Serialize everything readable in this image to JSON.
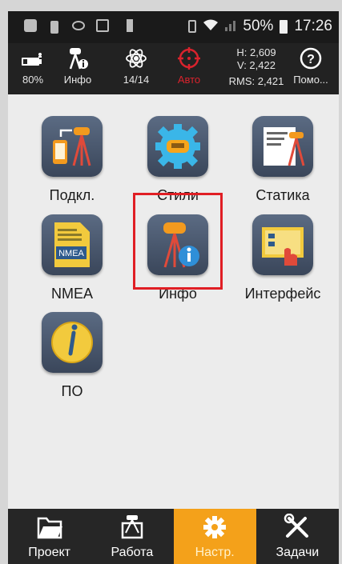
{
  "status_bar": {
    "battery_percent": "50%",
    "time": "17:26"
  },
  "toolbar": {
    "battery_label": "80%",
    "info_label": "Инфо",
    "satellites_label": "14/14",
    "solution_label": "Авто",
    "h_value": "H: 2,609",
    "v_value": "V: 2,422",
    "rms_value": "RMS: 2,421",
    "help_label": "Помо...",
    "help_glyph": "?"
  },
  "tiles": [
    {
      "label": "Подкл.",
      "icon": "connect-icon"
    },
    {
      "label": "Стили",
      "icon": "styles-icon",
      "selected": true
    },
    {
      "label": "Статика",
      "icon": "static-icon"
    },
    {
      "label": "NMEA",
      "icon": "nmea-icon",
      "badge": "NMEA"
    },
    {
      "label": "Инфо",
      "icon": "info-receiver-icon"
    },
    {
      "label": "Интерфейс",
      "icon": "interface-icon"
    },
    {
      "label": "ПО",
      "icon": "firmware-icon"
    }
  ],
  "bottom_nav": [
    {
      "label": "Проект",
      "icon": "folder-icon"
    },
    {
      "label": "Работа",
      "icon": "survey-icon"
    },
    {
      "label": "Настр.",
      "icon": "settings-icon",
      "active": true
    },
    {
      "label": "Задачи",
      "icon": "tools-icon"
    }
  ],
  "colors": {
    "accent": "#f4a11a",
    "selection": "#e01e24",
    "tile": "#4a576d"
  }
}
